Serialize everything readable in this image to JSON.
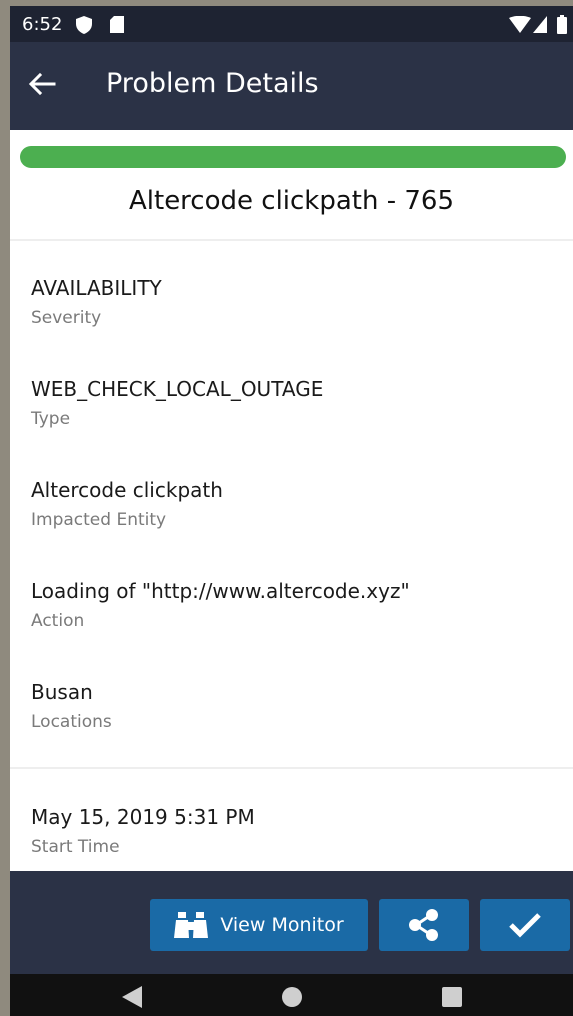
{
  "status_bar": {
    "time": "6:52",
    "icons": [
      "shield-icon",
      "sd-card-icon",
      "wifi-icon",
      "signal-icon",
      "battery-icon"
    ]
  },
  "app_bar": {
    "back_icon": "arrow-left-icon",
    "title": "Problem Details"
  },
  "progress": {
    "fraction": 1.0,
    "color": "#4caf50"
  },
  "problem": {
    "title": "Altercode clickpath - 765"
  },
  "fields": [
    {
      "value": "AVAILABILITY",
      "label": "Severity"
    },
    {
      "value": "WEB_CHECK_LOCAL_OUTAGE",
      "label": "Type"
    },
    {
      "value": "Altercode clickpath",
      "label": "Impacted Entity"
    },
    {
      "value": "Loading of \"http://www.altercode.xyz\"",
      "label": "Action"
    },
    {
      "value": "Busan",
      "label": "Locations"
    },
    {
      "value": "May 15, 2019 5:31 PM",
      "label": "Start Time"
    }
  ],
  "actions": {
    "view_monitor": {
      "label": "View Monitor",
      "icon": "binoculars-icon"
    },
    "share": {
      "icon": "share-icon"
    },
    "acknowledge": {
      "icon": "checkmark-icon"
    },
    "button_color": "#1a6aa6"
  },
  "nav_bar": {
    "icons": [
      "nav-back-icon",
      "nav-home-icon",
      "nav-recent-icon"
    ]
  },
  "colors": {
    "app_bar": "#2b3246",
    "status_bar": "#1e2332",
    "accent_green": "#4caf50"
  }
}
